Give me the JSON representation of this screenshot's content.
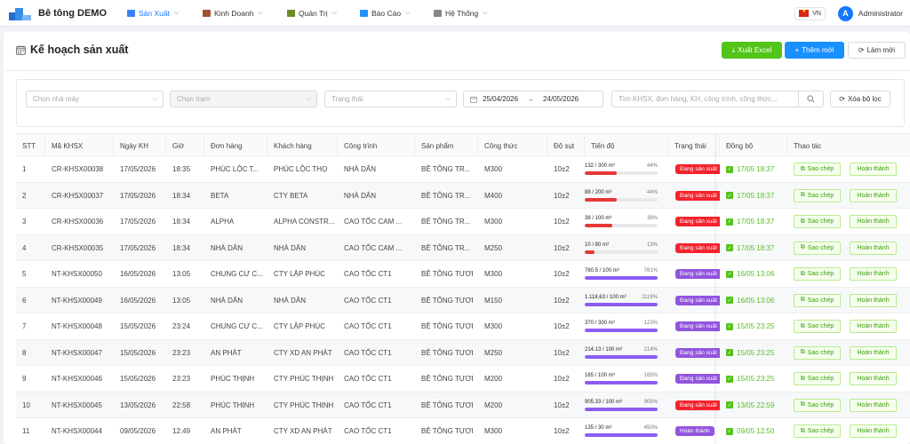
{
  "app": {
    "name": "Bê tông DEMO"
  },
  "nav": {
    "items": [
      {
        "label": "Sản Xuất",
        "active": true,
        "icon": "factory-icon",
        "color": "#3b82f6"
      },
      {
        "label": "Kinh Doanh",
        "active": false,
        "icon": "briefcase-icon",
        "color": "#a0522d"
      },
      {
        "label": "Quản Trị",
        "active": false,
        "icon": "admin-icon",
        "color": "#6b8e23"
      },
      {
        "label": "Báo Cáo",
        "active": false,
        "icon": "report-chart-icon",
        "color": "#1e90ff"
      },
      {
        "label": "Hệ Thống",
        "active": false,
        "icon": "gear-icon",
        "color": "#888888"
      }
    ],
    "language": "VN",
    "user_initial": "A",
    "user_name": "Administrator"
  },
  "page": {
    "title": "Kế hoạch sản xuất",
    "btn_excel": "Xuất Excel",
    "btn_add": "Thêm mới",
    "btn_refresh": "Làm mới"
  },
  "filters": {
    "factory_placeholder": "Chọn nhà máy",
    "station_placeholder": "Chọn trạm",
    "status_placeholder": "Trạng thái",
    "date_from": "25/04/2026",
    "date_to": "24/05/2026",
    "search_placeholder": "Tìm KHSX, đơn hàng, KH, công trình, công thức...",
    "clear_label": "Xóa bộ lọc"
  },
  "table": {
    "columns": [
      "STT",
      "Mã KHSX",
      "Ngày KH",
      "Giờ",
      "Đơn hàng",
      "Khách hàng",
      "Công trình",
      "Sản phẩm",
      "Công thức",
      "Độ sụt",
      "Tiến độ",
      "Trạng thái",
      "Đồng bộ",
      "Thao tác"
    ],
    "copy_label": "Sao chép",
    "done_label": "Hoàn thành",
    "rows": [
      {
        "stt": "1",
        "code": "CR-KHSX00038",
        "date": "17/05/2026",
        "time": "18:35",
        "order": "PHÚC LỘC T...",
        "customer": "PHÚC LỘC THỌ",
        "project": "NHÀ DÂN",
        "product": "BÊ TÔNG TR...",
        "formula": "M300",
        "slump": "10±2",
        "progress_text": "132 / 300 m³",
        "progress_pct": "44%",
        "progress": 44,
        "status": "Đang sản xuất",
        "status_color": "#f5222d",
        "bar_color": "#e53935",
        "sync": "17/05 18:37"
      },
      {
        "stt": "2",
        "code": "CR-KHSX00037",
        "date": "17/05/2026",
        "time": "18:34",
        "order": "BETA",
        "customer": "CTY BETA",
        "project": "NHÀ DÂN",
        "product": "BÊ TÔNG TR...",
        "formula": "M400",
        "slump": "10±2",
        "progress_text": "88 / 200 m³",
        "progress_pct": "44%",
        "progress": 44,
        "status": "Đang sản xuất",
        "status_color": "#f5222d",
        "bar_color": "#e53935",
        "sync": "17/05 18:37"
      },
      {
        "stt": "3",
        "code": "CR-KHSX00036",
        "date": "17/05/2026",
        "time": "18:34",
        "order": "ALPHA",
        "customer": "ALPHA CONSTR...",
        "project": "CAO TỐC CAM ...",
        "product": "BÊ TÔNG TR...",
        "formula": "M300",
        "slump": "10±2",
        "progress_text": "38 / 100 m³",
        "progress_pct": "38%",
        "progress": 38,
        "status": "Đang sản xuất",
        "status_color": "#f5222d",
        "bar_color": "#e53935",
        "sync": "17/05 18:37"
      },
      {
        "stt": "4",
        "code": "CR-KHSX00035",
        "date": "17/05/2026",
        "time": "18:34",
        "order": "NHÀ DÂN",
        "customer": "NHÀ DÂN",
        "project": "CAO TỐC CAM ...",
        "product": "BÊ TÔNG TR...",
        "formula": "M250",
        "slump": "10±2",
        "progress_text": "10 / 80 m³",
        "progress_pct": "13%",
        "progress": 13,
        "status": "Đang sản xuất",
        "status_color": "#f5222d",
        "bar_color": "#e53935",
        "sync": "17/05 18:37"
      },
      {
        "stt": "5",
        "code": "NT-KHSX00050",
        "date": "16/05/2026",
        "time": "13:05",
        "order": "CHUNG CƯ C...",
        "customer": "CTY LẬP PHÚC",
        "project": "CAO TỐC CT1",
        "product": "BÊ TÔNG TƯƠI",
        "formula": "M300",
        "slump": "10±2",
        "progress_text": "760.5 / 100 m³",
        "progress_pct": "761%",
        "progress": 100,
        "status": "Đang sản xuất",
        "status_color": "#9254de",
        "bar_color": "#8b5cf6",
        "sync": "16/05 13:06"
      },
      {
        "stt": "6",
        "code": "NT-KHSX00049",
        "date": "16/05/2026",
        "time": "13:05",
        "order": "NHÀ DÂN",
        "customer": "NHÀ DÂN",
        "project": "CAO TỐC CT1",
        "product": "BÊ TÔNG TƯƠI",
        "formula": "M150",
        "slump": "10±2",
        "progress_text": "1.118,63 / 100 m³",
        "progress_pct": "1119%",
        "progress": 100,
        "status": "Đang sản xuất",
        "status_color": "#9254de",
        "bar_color": "#8b5cf6",
        "sync": "16/05 13:06"
      },
      {
        "stt": "7",
        "code": "NT-KHSX00048",
        "date": "15/05/2026",
        "time": "23:24",
        "order": "CHUNG CƯ C...",
        "customer": "CTY LẬP PHÚC",
        "project": "CAO TỐC CT1",
        "product": "BÊ TÔNG TƯƠI",
        "formula": "M300",
        "slump": "10±2",
        "progress_text": "370 / 300 m³",
        "progress_pct": "123%",
        "progress": 100,
        "status": "Đang sản xuất",
        "status_color": "#9254de",
        "bar_color": "#8b5cf6",
        "sync": "15/05 23:25"
      },
      {
        "stt": "8",
        "code": "NT-KHSX00047",
        "date": "15/05/2026",
        "time": "23:23",
        "order": "AN PHÁT",
        "customer": "CTY XD AN PHÁT",
        "project": "CAO TỐC CT1",
        "product": "BÊ TÔNG TƯƠI",
        "formula": "M250",
        "slump": "10±2",
        "progress_text": "214.13 / 100 m³",
        "progress_pct": "214%",
        "progress": 100,
        "status": "Đang sản xuất",
        "status_color": "#9254de",
        "bar_color": "#8b5cf6",
        "sync": "15/05 23:25"
      },
      {
        "stt": "9",
        "code": "NT-KHSX00046",
        "date": "15/05/2026",
        "time": "23:23",
        "order": "PHÚC THỊNH",
        "customer": "CTY PHÚC THỊNH",
        "project": "CAO TỐC CT1",
        "product": "BÊ TÔNG TƯƠI",
        "formula": "M200",
        "slump": "10±2",
        "progress_text": "165 / 100 m³",
        "progress_pct": "165%",
        "progress": 100,
        "status": "Đang sản xuất",
        "status_color": "#9254de",
        "bar_color": "#8b5cf6",
        "sync": "15/05 23:25"
      },
      {
        "stt": "10",
        "code": "NT-KHSX00045",
        "date": "13/05/2026",
        "time": "22:58",
        "order": "PHÚC THỊNH",
        "customer": "CTY PHÚC THỊNH",
        "project": "CAO TỐC CT1",
        "product": "BÊ TÔNG TƯƠI",
        "formula": "M200",
        "slump": "10±2",
        "progress_text": "905,33 / 100 m³",
        "progress_pct": "905%",
        "progress": 100,
        "status": "Đang sản xuất",
        "status_color": "#f5222d",
        "bar_color": "#8b5cf6",
        "sync": "13/05 22:59"
      },
      {
        "stt": "11",
        "code": "NT-KHSX00044",
        "date": "09/05/2026",
        "time": "12:49",
        "order": "AN PHÁT",
        "customer": "CTY XD AN PHÁT",
        "project": "CAO TỐC CT1",
        "product": "BÊ TÔNG TƯƠI",
        "formula": "M300",
        "slump": "10±2",
        "progress_text": "135 / 30 m³",
        "progress_pct": "450%",
        "progress": 100,
        "status": "Hoàn thành",
        "status_color": "#9254de",
        "bar_color": "#8b5cf6",
        "sync": "09/05 12:50"
      }
    ]
  }
}
